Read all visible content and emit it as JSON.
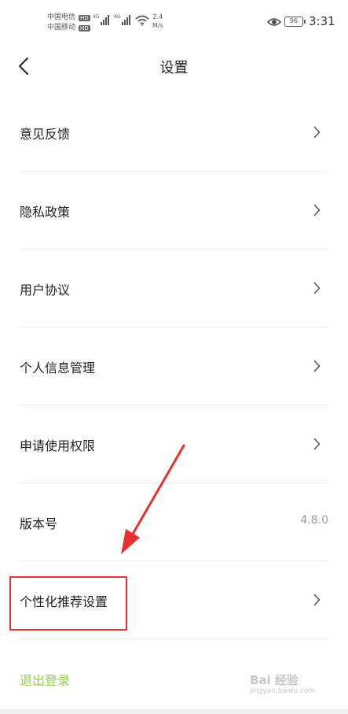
{
  "status_bar": {
    "carrier_1": "中国电信",
    "carrier_2": "中国移动",
    "hd_badge": "HD",
    "network_tag": "4G",
    "speed_value": "2.4",
    "speed_unit": "M/s",
    "battery": "96",
    "time": "3:31"
  },
  "nav": {
    "title": "设置"
  },
  "menu": {
    "items": [
      {
        "label": "意见反馈",
        "value": ""
      },
      {
        "label": "隐私政策",
        "value": ""
      },
      {
        "label": "用户协议",
        "value": ""
      },
      {
        "label": "个人信息管理",
        "value": ""
      },
      {
        "label": "申请使用权限",
        "value": ""
      },
      {
        "label": "版本号",
        "value": "4.8.0"
      },
      {
        "label": "个性化推荐设置",
        "value": ""
      }
    ]
  },
  "logout_label": "退出登录",
  "watermark": {
    "logo": "Bai 经验",
    "url": "jingyan.baidu.com"
  },
  "colors": {
    "accent_green": "#8fd14f",
    "annotation_red": "#e5322f",
    "divider": "#ececec"
  }
}
